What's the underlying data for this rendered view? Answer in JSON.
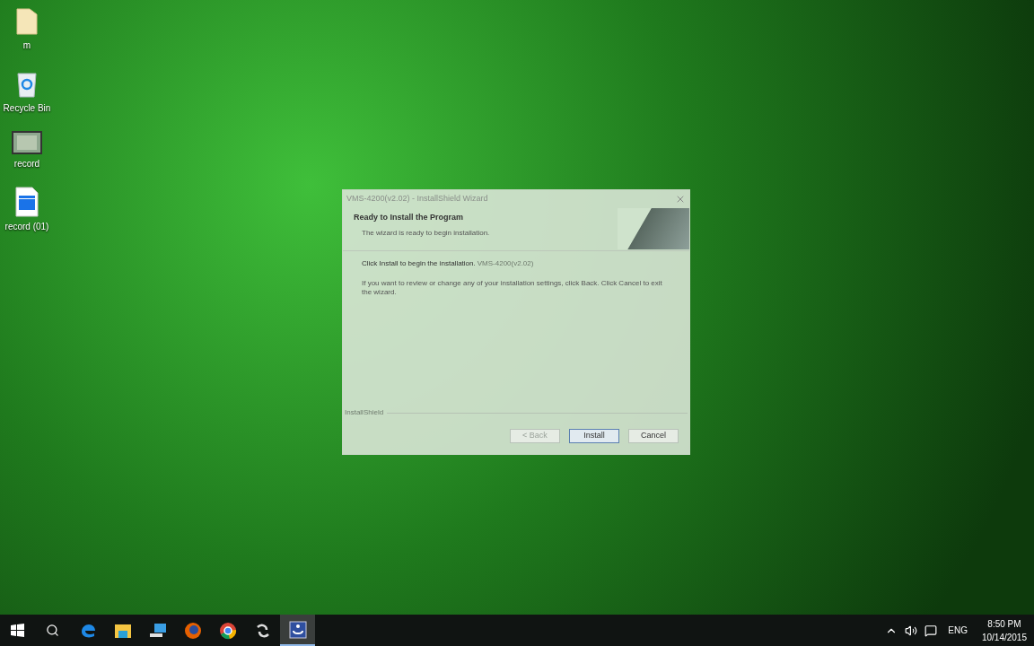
{
  "desktop_icons": [
    {
      "label": "m",
      "kind": "folder"
    },
    {
      "label": "Recycle Bin",
      "kind": "recycle"
    },
    {
      "label": "record",
      "kind": "video"
    },
    {
      "label": "record (01)",
      "kind": "clip"
    }
  ],
  "dialog": {
    "title": "VMS-4200(v2.02) - InstallShield Wizard",
    "heading": "Ready to Install the Program",
    "subheading": "The wizard is ready to begin installation.",
    "instruction": "Click Install to begin the installation.",
    "ghost_text": "VMS-4200(v2.02)",
    "body": "If you want to review or change any of your installation settings, click Back. Click Cancel to exit the wizard.",
    "brand": "InstallShield",
    "buttons": [
      {
        "label": "< Back",
        "disabled": true,
        "selected": false
      },
      {
        "label": "Install",
        "disabled": false,
        "selected": true
      },
      {
        "label": "Cancel",
        "disabled": false,
        "selected": false
      }
    ]
  },
  "taskbar": {
    "apps": [
      {
        "kind": "edge",
        "selected": false
      },
      {
        "kind": "explorer",
        "selected": false
      },
      {
        "kind": "computer",
        "selected": false
      },
      {
        "kind": "firefox",
        "selected": false
      },
      {
        "kind": "chrome",
        "selected": false
      },
      {
        "kind": "media",
        "selected": false
      },
      {
        "kind": "installer",
        "selected": true
      }
    ],
    "language": "ENG",
    "time": "8:50 PM",
    "date": "10/14/2015"
  }
}
